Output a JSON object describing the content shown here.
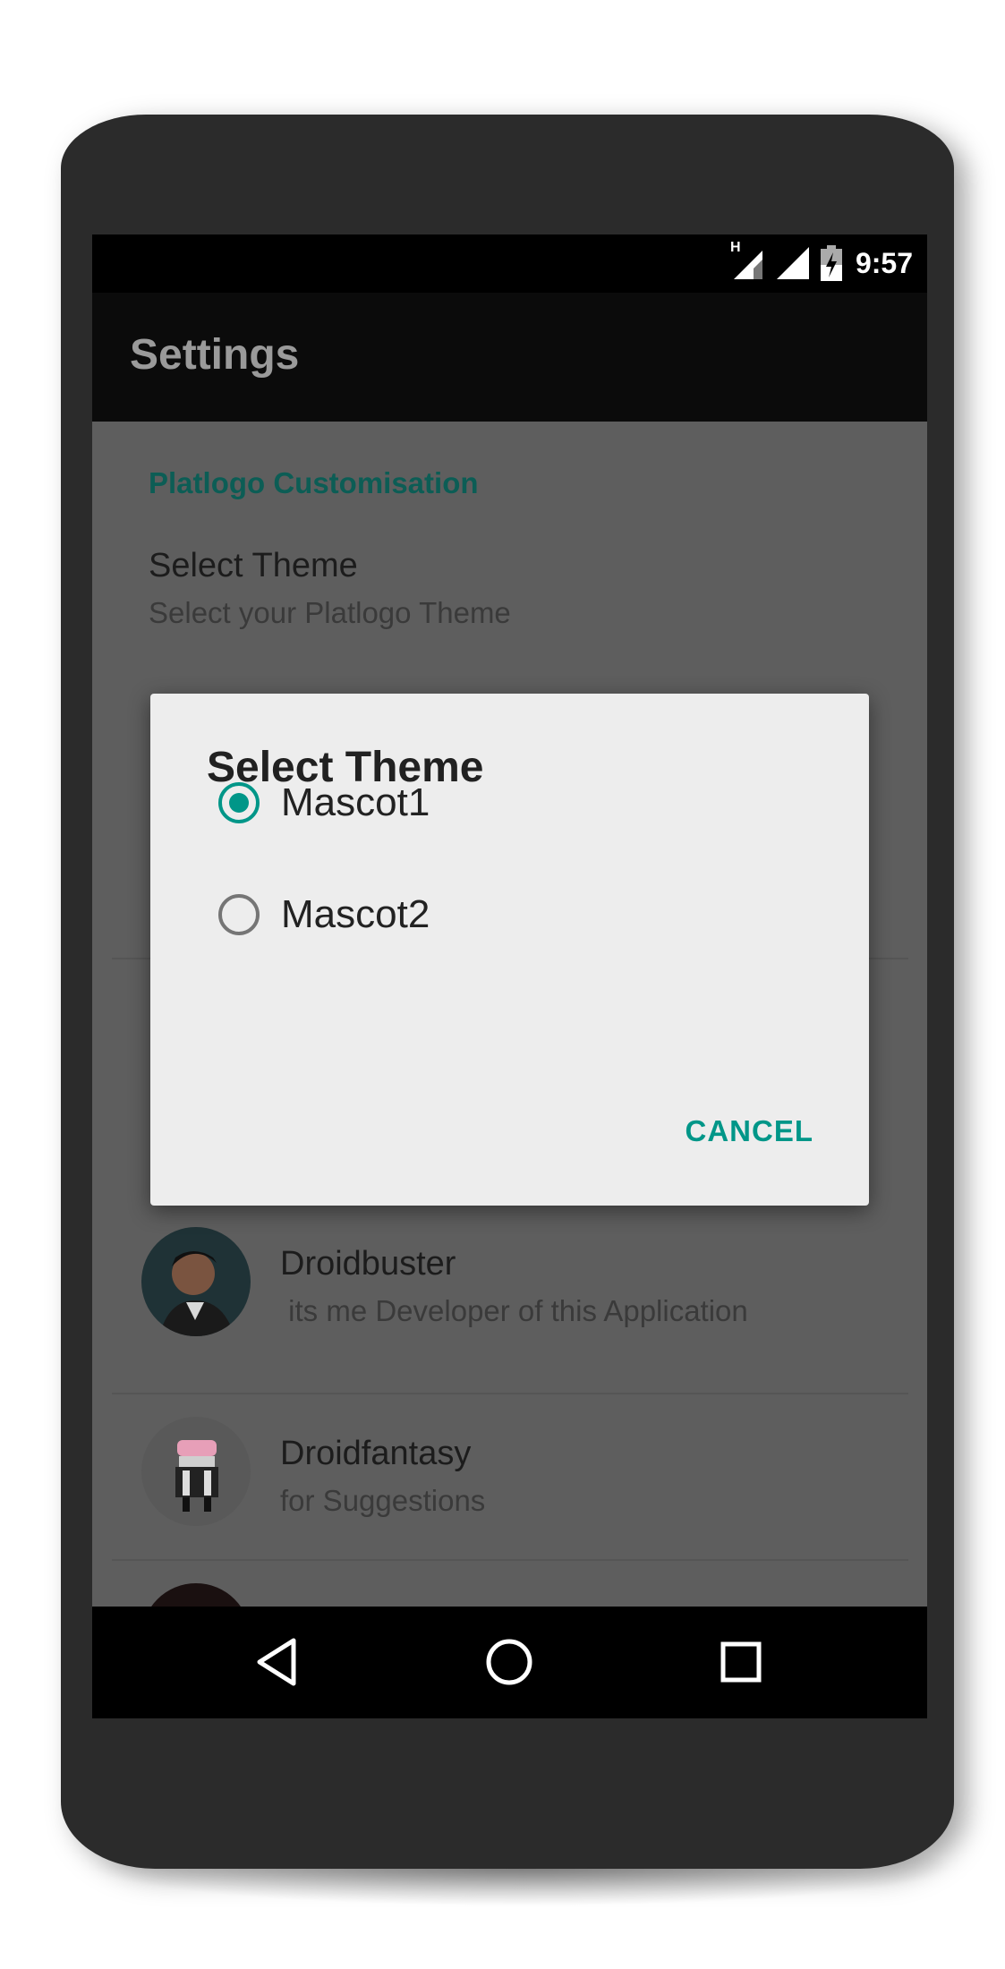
{
  "status_bar": {
    "network_label": "H",
    "time": "9:57"
  },
  "app_bar": {
    "title": "Settings"
  },
  "preferences": {
    "category": "Platlogo Customisation",
    "select_theme": {
      "title": "Select Theme",
      "summary": "Select your Platlogo Theme"
    }
  },
  "people": [
    {
      "name": "Droidbuster",
      "description": " its me Developer of this Application"
    },
    {
      "name": "Droidfantasy",
      "description": "for Suggestions"
    }
  ],
  "dialog": {
    "title": "Select Theme",
    "options": [
      {
        "label": "Mascot1",
        "checked": true
      },
      {
        "label": "Mascot2",
        "checked": false
      }
    ],
    "cancel_label": "CANCEL"
  },
  "colors": {
    "accent": "#009688",
    "category_text": "#0c5d55",
    "scrim_background": "#5e5e5e",
    "phone_body": "#2b2b2b"
  },
  "icons": {
    "nav_back": "back-triangle-icon",
    "nav_home": "home-circle-icon",
    "nav_recents": "recents-square-icon"
  }
}
